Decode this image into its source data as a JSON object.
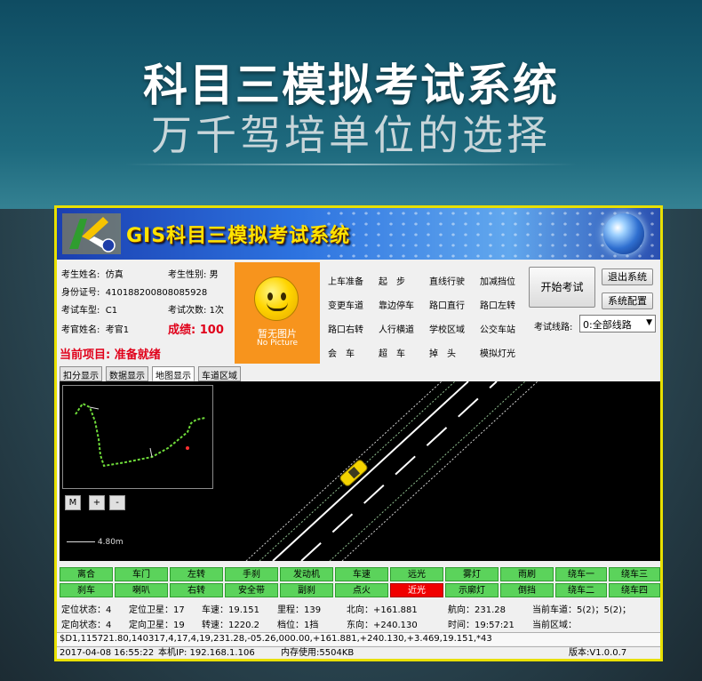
{
  "hero": {
    "title": "科目三模拟考试系统",
    "subtitle": "万千驾培单位的选择"
  },
  "banner": {
    "title": "GIS科目三模拟考试系统"
  },
  "candidate": {
    "name_label": "考生姓名:",
    "name": "仿真",
    "gender_label": "考生性别:",
    "gender": "男",
    "id_label": "身份证号:",
    "id": "410188200808085928",
    "car_label": "考试车型:",
    "car": "C1",
    "count_label": "考试次数:",
    "count": "1次",
    "examiner_label": "考官姓名:",
    "examiner": "考官1",
    "score_label": "成绩:",
    "score": "100",
    "current_label": "当前项目:",
    "current": "准备就绪"
  },
  "photo": {
    "text": "暂无图片",
    "text_en": "No Picture"
  },
  "exam_items": [
    [
      "上车准备",
      "起　步",
      "直线行驶",
      "加减挡位"
    ],
    [
      "变更车道",
      "靠边停车",
      "路口直行",
      "路口左转"
    ],
    [
      "路口右转",
      "人行横道",
      "学校区域",
      "公交车站"
    ],
    [
      "会　车",
      "超　车",
      "掉　头",
      "模拟灯光"
    ]
  ],
  "buttons": {
    "start": "开始考试",
    "exit": "退出系统",
    "config": "系统配置"
  },
  "route": {
    "label": "考试线路:",
    "selected": "0:全部线路"
  },
  "tabs": [
    "扣分显示",
    "数据显示",
    "地图显示",
    "车道区域"
  ],
  "active_tab": "地图显示",
  "map": {
    "zoom_m": "M",
    "zoom_in": "+",
    "zoom_out": "-",
    "scale": "4.80m"
  },
  "signals_row1": [
    "离合",
    "车门",
    "左转",
    "手刹",
    "发动机",
    "车速",
    "远光",
    "雾灯",
    "雨刷",
    "绕车一",
    "绕车三"
  ],
  "signals_row2": [
    "刹车",
    "喇叭",
    "右转",
    "安全带",
    "副刹",
    "点火",
    "近光",
    "示廓灯",
    "倒挡",
    "绕车二",
    "绕车四"
  ],
  "active_signal": "近光",
  "telemetry": {
    "row1": [
      "定位状态：4",
      "定位卫星：17",
      "车速：19.151",
      "里程：139",
      "北向：+161.881",
      "航向：231.28",
      "当前车道：5(2)；5(2)；"
    ],
    "row2": [
      "定向状态：4",
      "定向卫星：19",
      "转速：1220.2",
      "档位：1挡",
      "东向：+240.130",
      "时间：19:57:21",
      "当前区域："
    ]
  },
  "raw_data": "$D1,115721.80,140317,4,17,4,19,231.28,-05.26,000.00,+161.881,+240.130,+3.469,19.151,*43",
  "footer": {
    "datetime": "2017-04-08 16:55:22",
    "ip": "本机IP: 192.168.1.106",
    "memory": "内存使用:5504KB",
    "version": "版本:V1.0.0.7"
  },
  "colors": {
    "accent_yellow": "#e8e000",
    "signal_green": "#5bd35b",
    "signal_red": "#f00000",
    "photo_orange": "#f7941d",
    "score_red": "#e0001a"
  }
}
